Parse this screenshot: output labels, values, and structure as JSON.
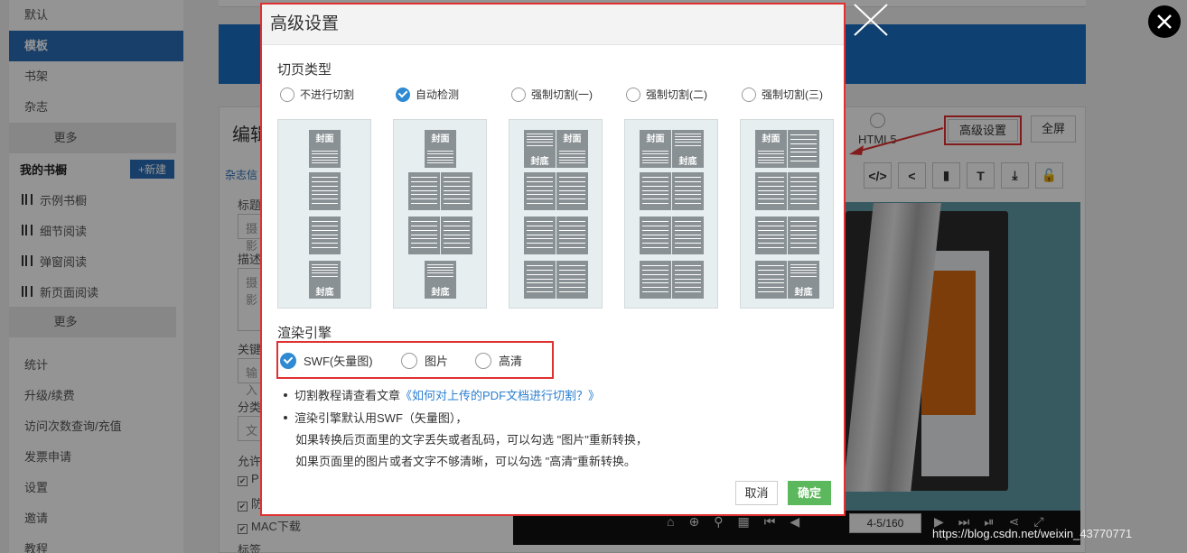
{
  "sidebar": {
    "top_items": [
      "默认",
      "模板",
      "书架",
      "杂志"
    ],
    "more1": "更多",
    "my_shelf": "我的书橱",
    "new_button": "+新建",
    "books": [
      "示例书橱",
      "细节阅读",
      "弹窗阅读",
      "新页面阅读"
    ],
    "more2": "更多",
    "bottom_items": [
      "统计",
      "升级/续费",
      "访问次数查询/充值",
      "发票申请",
      "设置",
      "邀请",
      "教程"
    ]
  },
  "editor": {
    "title": "编辑",
    "link": "杂志信",
    "labels": [
      "标题",
      "描述",
      "关键",
      "分类",
      "允许"
    ],
    "fields": [
      "摄影",
      "摄影",
      "输入",
      "文"
    ],
    "checks": [
      "P",
      "防",
      "MAC下载"
    ],
    "tags_label": "标签",
    "html5_label": "HTML5",
    "advanced_button": "高级设置",
    "fullscreen_button": "全屏",
    "tool_labels": [
      "</>",
      "<",
      "▮",
      "T",
      "⤓",
      "🔓"
    ],
    "page_indicator": "4-5/160"
  },
  "dialog": {
    "title": "高级设置",
    "cut_section": "切页类型",
    "cut_options": [
      "不进行切割",
      "自动检测",
      "强制切割(一)",
      "强制切割(二)",
      "强制切割(三)"
    ],
    "cut_selected": "自动检测",
    "cover_label": "封面",
    "back_label": "封底",
    "render_section": "渲染引擎",
    "render_options": [
      "SWF(矢量图)",
      "图片",
      "高清"
    ],
    "render_selected": "SWF(矢量图)",
    "note1_prefix": "切割教程请查看文章",
    "note1_link": "《如何对上传的PDF文档进行切割？》",
    "note2": "渲染引擎默认用SWF（矢量图），",
    "note3": "如果转换后页面里的文字丢失或者乱码，可以勾选 \"图片\"重新转换，",
    "note4": "如果页面里的图片或者文字不够清晰，可以勾选 \"高清\"重新转换。",
    "cancel": "取消",
    "confirm": "确定"
  },
  "watermark": "https://blog.csdn.net/weixin_43770771",
  "colors": {
    "accent": "#2a6db5",
    "highlight_box": "#e03030",
    "confirm": "#5cb85c",
    "link": "#2a7fd0"
  }
}
